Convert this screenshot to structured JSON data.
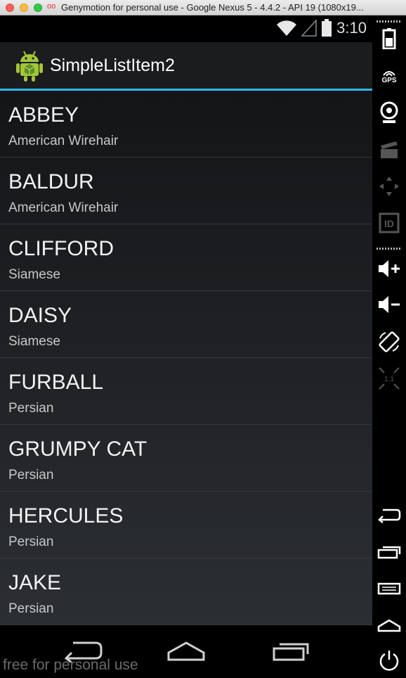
{
  "window": {
    "title": "Genymotion for personal use - Google Nexus 5 - 4.4.2 - API 19 (1080x19...",
    "logo_glyph": "oo"
  },
  "statusbar": {
    "time": "3:10"
  },
  "actionbar": {
    "title": "SimpleListItem2"
  },
  "list": {
    "items": [
      {
        "title": "ABBEY",
        "subtitle": "American Wirehair"
      },
      {
        "title": "BALDUR",
        "subtitle": "American Wirehair"
      },
      {
        "title": "CLIFFORD",
        "subtitle": "Siamese"
      },
      {
        "title": "DAISY",
        "subtitle": "Siamese"
      },
      {
        "title": "FURBALL",
        "subtitle": "Persian"
      },
      {
        "title": "GRUMPY CAT",
        "subtitle": "Persian"
      },
      {
        "title": "HERCULES",
        "subtitle": "Persian"
      },
      {
        "title": "JAKE",
        "subtitle": "Persian"
      }
    ]
  },
  "navbar": {
    "watermark": "free for personal use"
  },
  "sidepanel": {
    "gps_label": "GPS",
    "id_label": "ID",
    "scale_label": "1:1"
  },
  "colors": {
    "holo_blue": "#33b5e5",
    "actionbar_bg": "#1b1c1e",
    "android_green": "#a4c639"
  }
}
